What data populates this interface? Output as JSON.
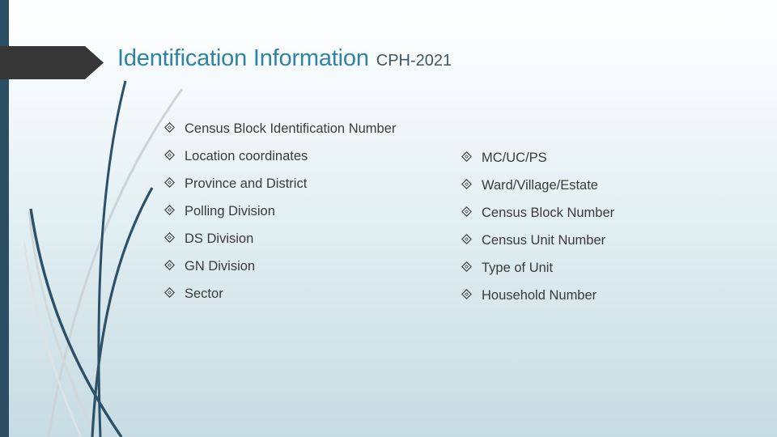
{
  "slide": {
    "title_main": "Identification Information",
    "title_sub": "CPH-2021",
    "bullet_glyph_name": "diamond-bullet-icon",
    "colors": {
      "title_accent": "#2e83a3",
      "title_sub": "#3f5560",
      "left_strip": "#2c4e63",
      "banner": "#373737",
      "body_text": "#3b3b3b",
      "swoosh_dark": "#2c5068",
      "swoosh_light": "#ccd4d8",
      "background_top": "#fdfeff",
      "background_bottom": "#c7dce3"
    }
  },
  "left_column": [
    {
      "label": "Census Block Identification Number"
    },
    {
      "label": "Location coordinates"
    },
    {
      "label": "Province and District"
    },
    {
      "label": "Polling Division"
    },
    {
      "label": "DS Division"
    },
    {
      "label": "GN Division"
    },
    {
      "label": "Sector"
    }
  ],
  "right_column": [
    {
      "label": "MC/UC/PS"
    },
    {
      "label": "Ward/Village/Estate"
    },
    {
      "label": "Census Block Number"
    },
    {
      "label": "Census Unit Number"
    },
    {
      "label": "Type of Unit"
    },
    {
      "label": "Household Number"
    }
  ]
}
